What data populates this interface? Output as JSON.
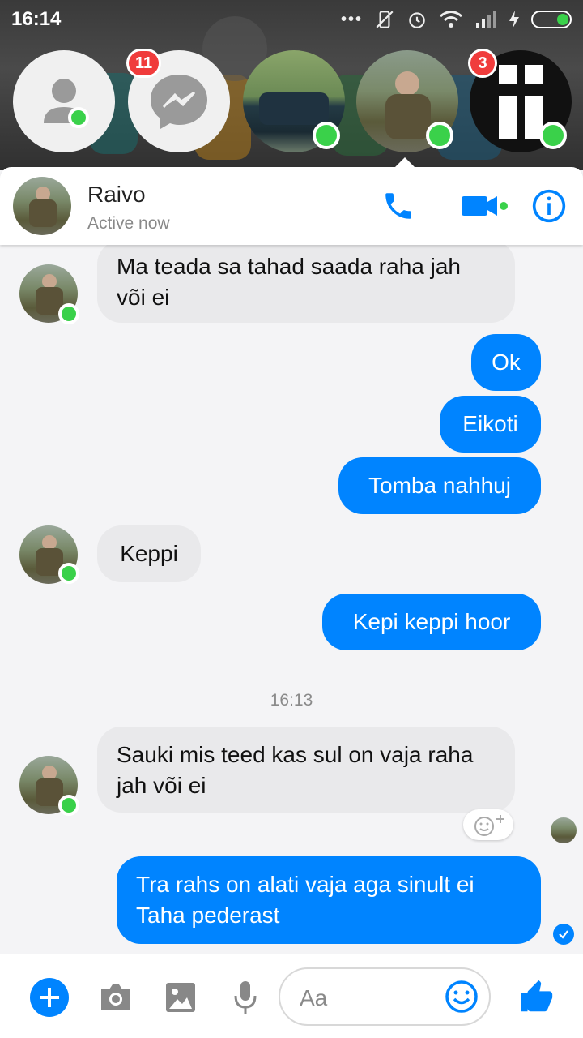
{
  "status_bar": {
    "time": "16:14"
  },
  "chat_heads": [
    {
      "name": "contacts-head",
      "badge": ""
    },
    {
      "name": "messenger-head",
      "badge": "11"
    },
    {
      "name": "car-head",
      "badge": ""
    },
    {
      "name": "raivo-head",
      "badge": ""
    },
    {
      "name": "cross-head",
      "badge": "3"
    }
  ],
  "header": {
    "name": "Raivo",
    "status": "Active now"
  },
  "messages": [
    {
      "dir": "in",
      "text": "Ma teada sa tahad saada raha jah või ei"
    },
    {
      "dir": "out",
      "text": "Ok"
    },
    {
      "dir": "out",
      "text": "Eikoti"
    },
    {
      "dir": "out",
      "text": "Tomba nahhuj"
    },
    {
      "dir": "in",
      "text": "Keppi"
    },
    {
      "dir": "out",
      "text": "Kepi keppi hoor"
    },
    {
      "dir": "timestamp",
      "text": "16:13"
    },
    {
      "dir": "in",
      "text": "Sauki mis teed kas sul on vaja raha jah või ei"
    },
    {
      "dir": "out",
      "text": "Tra rahs on alati vaja aga sinult ei Taha pederast"
    }
  ],
  "composer": {
    "placeholder": "Aa"
  },
  "colors": {
    "accent": "#0084ff",
    "online": "#3ad14a",
    "badge": "#f03c3c",
    "incoming_bubble": "#e9e9eb"
  }
}
